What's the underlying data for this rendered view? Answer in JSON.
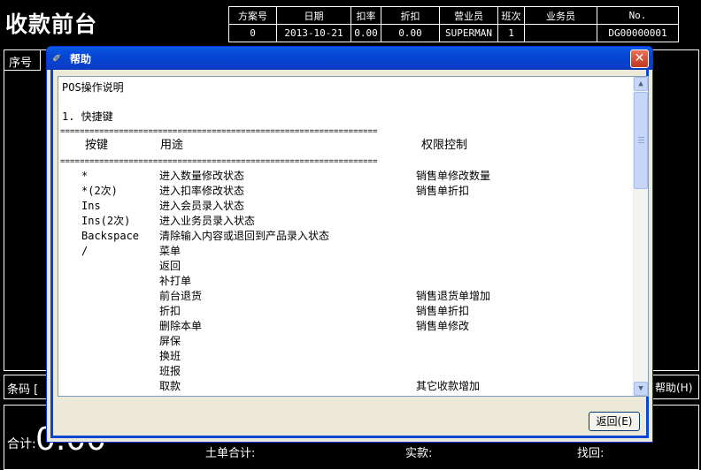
{
  "app": {
    "title": "收款前台"
  },
  "info_table": {
    "headers": [
      "方案号",
      "日期",
      "扣率",
      "折扣",
      "营业员",
      "班次",
      "业务员",
      "No."
    ],
    "values": [
      "0",
      "2013-10-21",
      "0.00",
      "0.00",
      "SUPERMAN",
      "1",
      "",
      "DG00000001"
    ]
  },
  "background": {
    "seq_label": "序号",
    "barcode_label": "条码 [",
    "help_button": "帮助(H)",
    "total_label": "合计:",
    "total_value": "0.00",
    "partial_1": "土单合计:",
    "partial_2": "实款:",
    "partial_3": "找回:"
  },
  "dialog": {
    "title": "帮助",
    "close_glyph": "✕",
    "return_button": "返回(E)",
    "content": {
      "heading": "POS操作说明",
      "section": "1. 快捷键",
      "divider": "=================================================================",
      "columns": [
        "按键",
        "用途",
        "权限控制"
      ],
      "rows": [
        {
          "key": "*",
          "use": "进入数量修改状态",
          "perm": "销售单修改数量"
        },
        {
          "key": "*(2次)",
          "use": "进入扣率修改状态",
          "perm": "销售单折扣"
        },
        {
          "key": "Ins",
          "use": "进入会员录入状态",
          "perm": ""
        },
        {
          "key": "Ins(2次)",
          "use": "进入业务员录入状态",
          "perm": ""
        },
        {
          "key": "Backspace",
          "use": "清除输入内容或退回到产品录入状态",
          "perm": ""
        },
        {
          "key": "/",
          "use": "菜单",
          "perm": ""
        },
        {
          "key": "",
          "use": "返回",
          "perm": ""
        },
        {
          "key": "",
          "use": "补打单",
          "perm": ""
        },
        {
          "key": "",
          "use": "前台退货",
          "perm": "销售退货单增加"
        },
        {
          "key": "",
          "use": "折扣",
          "perm": "销售单折扣"
        },
        {
          "key": "",
          "use": "删除本单",
          "perm": "销售单修改"
        },
        {
          "key": "",
          "use": "屏保",
          "perm": ""
        },
        {
          "key": "",
          "use": "换班",
          "perm": ""
        },
        {
          "key": "",
          "use": "班报",
          "perm": ""
        },
        {
          "key": "",
          "use": "取款",
          "perm": "其它收款增加"
        }
      ]
    }
  }
}
